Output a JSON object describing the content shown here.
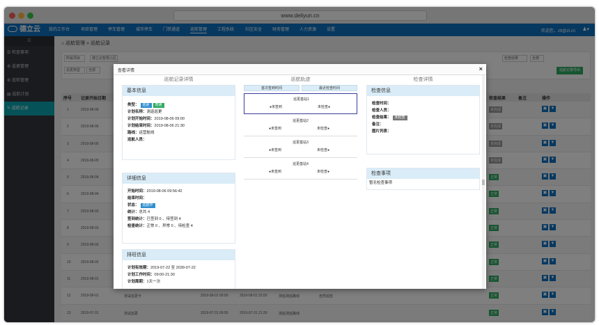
{
  "browser": {
    "url": "www.deliyun.cn"
  },
  "nav": {
    "logo": "德立云",
    "items": [
      "我的工作台",
      "项目管理",
      "停车管理",
      "城市停车",
      "门禁通道",
      "巡航管理",
      "工程系统",
      "社区安全",
      "财务管理",
      "人力资源",
      "设置"
    ],
    "active_index": 5,
    "user": "欢迎您，ztt@zt.cn",
    "user_icon": "user-icon"
  },
  "sidebar": {
    "header": "☰",
    "items": [
      "检查事项",
      "巡更管理",
      "巡检管理",
      "巡航计划",
      "巡航记录"
    ],
    "active_index": 4
  },
  "breadcrumb": {
    "home": "巡航管理",
    "sep": "»",
    "current": "巡航记录"
  },
  "filters": {
    "f1": "所属项目",
    "f2": "德立云智慧小区",
    "f3": "巡更类型",
    "f4": "全部",
    "f5": "检查结果",
    "f6": "全部",
    "export": "巡航记录导出"
  },
  "table": {
    "headers": [
      "序号",
      "记录开始日期",
      "检查结果",
      "备注",
      "操作"
    ],
    "rows": [
      {
        "no": "1",
        "date": "2019-08-06",
        "result": "未完成"
      },
      {
        "no": "2",
        "date": "2019-08-06",
        "result": "未完成"
      },
      {
        "no": "3",
        "date": "2019-08-05",
        "result": "未完成"
      },
      {
        "no": "4",
        "date": "2019-08-05",
        "result": "未完成"
      },
      {
        "no": "5",
        "date": "2019-08-04",
        "result": "正常"
      },
      {
        "no": "6",
        "date": "2019-08-04",
        "result": "正常"
      },
      {
        "no": "7",
        "date": "2019-08-03",
        "result": "正常"
      },
      {
        "no": "8",
        "date": "2019-08-03",
        "result": "正常"
      },
      {
        "no": "9",
        "date": "2019-08-02",
        "result": "正常"
      },
      {
        "no": "10",
        "date": "2019-08-02",
        "result": "正常"
      },
      {
        "no": "11",
        "date": "2019-08-01",
        "result": "正常"
      },
      {
        "no": "12",
        "date": "2019-08-01",
        "result": "正常"
      },
      {
        "no": "13",
        "date": "2019-07-31",
        "result": "正常"
      }
    ],
    "row12_extra": {
      "name": "测试巡更卡",
      "time1": "2019-08-01 09:00",
      "time2": "2019-08-01 22:00",
      "type": "测巡测巡路线",
      "note": "自然巡检"
    },
    "row13_extra": {
      "name": "测试巡更",
      "time1": "2019-07-31 09:00",
      "time2": "2019-07-31 21:30",
      "type": "测巡测巡路线"
    }
  },
  "modal": {
    "title": "查看详情",
    "close": "×",
    "col1_title": "巡航记录详情",
    "col2_title": "巡航轨迹",
    "col3_title": "检查详情",
    "basic": {
      "title": "基本信息",
      "type_label": "类型：",
      "type_badge1": "巡更",
      "type_badge2": "普通",
      "plan_label": "计划名称：",
      "plan": "测巡巡更",
      "start_label": "计划开始时间：",
      "start": "2019-08-06 09:00",
      "end_label": "计划结束时间：",
      "end": "2019-08-06 21:30",
      "route_label": "路线：",
      "route": "运营航线",
      "inspector_label": "巡航人员："
    },
    "detail": {
      "title": "详细信息",
      "begin_label": "开始时间：",
      "begin": "2019-08-06 09:56:42",
      "finish_label": "结束时间：",
      "status_label": "状态：",
      "status": "巡航中",
      "count_label": "统计：",
      "count": "总共 4",
      "sign_label": "签到统计：",
      "sign": "已签到 0 、待签到 4",
      "check_label": "检查统计：",
      "check": "正常 0 、异常 0 、待检查 4"
    },
    "schedule": {
      "title": "排班信息",
      "valid_label": "计划有效期：",
      "valid": "2019-07-22 至 2039-07-22",
      "work_label": "计划工作时间：",
      "work": "09:00-21:30",
      "cycle_label": "计划周期：",
      "cycle": "1天一次"
    },
    "track": {
      "head_left": "首次签到时间",
      "head_right": "最近检查时间",
      "stations": [
        {
          "name": "巡更基站1",
          "left": "●未签到",
          "right": "未检查●"
        },
        {
          "name": "巡更基站2",
          "left": "●未签到",
          "right": "未检查●"
        },
        {
          "name": "巡更基站3",
          "left": "●未签到",
          "right": "未检查●"
        },
        {
          "name": "巡更基站4",
          "left": "●未签到",
          "right": "未检查●"
        }
      ]
    },
    "checkinfo": {
      "title": "检查信息",
      "time_label": "检查时间：",
      "person_label": "检查人员：",
      "result_label": "检查结果：",
      "result": "未检查",
      "note_label": "备注：",
      "img_label": "图片列表："
    },
    "items": {
      "title": "检查事项",
      "empty": "暂无检查事项"
    }
  }
}
